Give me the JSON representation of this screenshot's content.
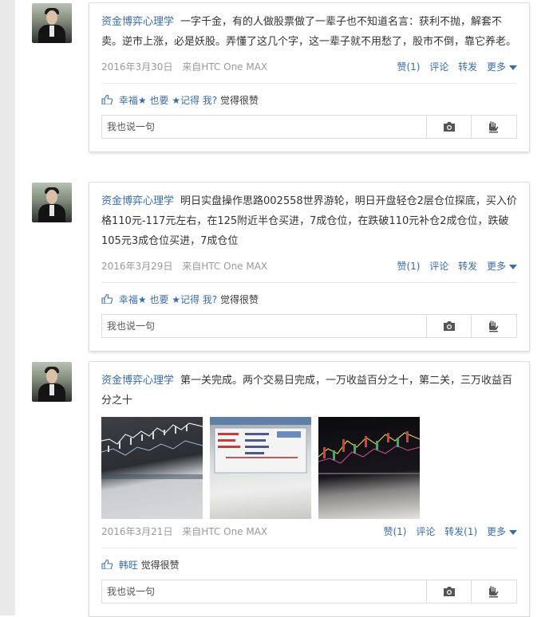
{
  "comment_placeholder": "我也说一句",
  "posts": [
    {
      "author": "资金博弈心理学",
      "text": "一字千金，有的人做股票做了一辈子也不知道名言：获利不抛，解套不卖。逆市上涨，必是妖股。弄懂了这几个字，这一辈子就不用愁了，股市不倒，靠它养老。",
      "date": "2016年3月30日",
      "source": "来自HTC One MAX",
      "actions": {
        "like": "赞(1)",
        "comment": "评论",
        "forward": "转发",
        "more": "更多"
      },
      "likes_names": "幸福★ 也要 ★记得 我?",
      "likes_suffix": "觉得很赞"
    },
    {
      "author": "资金博弈心理学",
      "text": "明日实盘操作思路002558世界游轮，明日开盘轻仓2层仓位探底，买入价格110元-117元左右，在125附近半仓买进，7成仓位，在跌破110元补仓2成仓位，跌破105元3成仓位买进，7成仓位",
      "date": "2016年3月29日",
      "source": "来自HTC One MAX",
      "actions": {
        "like": "赞(1)",
        "comment": "评论",
        "forward": "转发",
        "more": "更多"
      },
      "likes_names": "幸福★ 也要 ★记得 我?",
      "likes_suffix": "觉得很赞"
    },
    {
      "author": "资金博弈心理学",
      "text": "第一关完成。两个交易日完成，一万收益百分之十，第二关，三万收益百分之十",
      "date": "2016年3月21日",
      "source": "来自HTC One MAX",
      "actions": {
        "like": "赞(1)",
        "comment": "评论",
        "forward": "转发(1)",
        "more": "更多"
      },
      "likes_names": "韩旺",
      "likes_suffix": "觉得很赞"
    }
  ],
  "colors": {
    "link": "#3a6ca8",
    "meta": "#999999",
    "border": "#dcdcdc"
  },
  "icons": {
    "like": "thumbs-up-icon",
    "camera": "camera-icon",
    "stamp": "stamp-icon",
    "more": "triangle-down-icon"
  }
}
